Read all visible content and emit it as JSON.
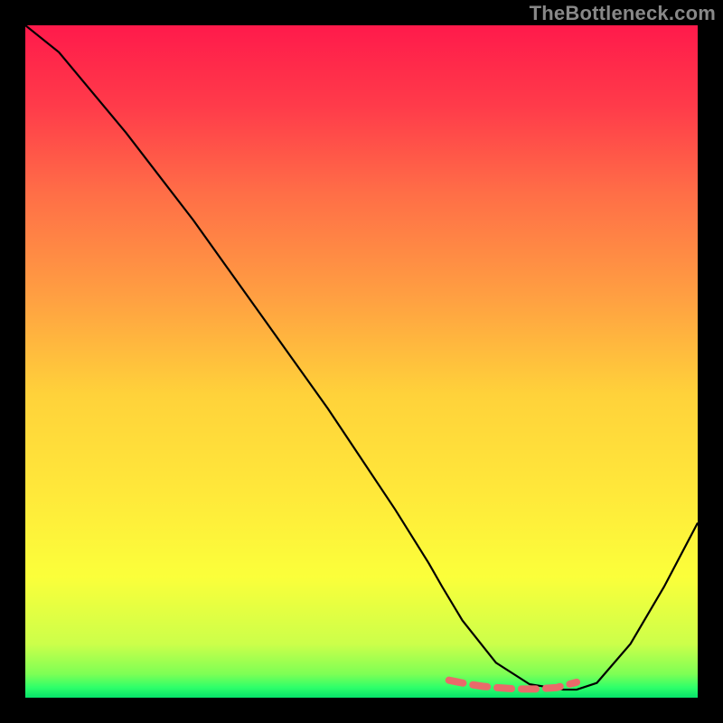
{
  "watermark": "TheBottleneck.com",
  "gradient": {
    "stops": [
      {
        "offset": 0.0,
        "color": "#ff1a4b"
      },
      {
        "offset": 0.12,
        "color": "#ff3b4a"
      },
      {
        "offset": 0.25,
        "color": "#ff6e47"
      },
      {
        "offset": 0.4,
        "color": "#ff9e42"
      },
      {
        "offset": 0.55,
        "color": "#ffd23a"
      },
      {
        "offset": 0.7,
        "color": "#ffe93a"
      },
      {
        "offset": 0.82,
        "color": "#fbff3a"
      },
      {
        "offset": 0.92,
        "color": "#ccff4a"
      },
      {
        "offset": 0.965,
        "color": "#7dff55"
      },
      {
        "offset": 0.985,
        "color": "#2dff6a"
      },
      {
        "offset": 1.0,
        "color": "#06e26a"
      }
    ]
  },
  "chart_data": {
    "type": "line",
    "title": "",
    "xlabel": "",
    "ylabel": "",
    "xlim": [
      0,
      100
    ],
    "ylim": [
      0,
      100
    ],
    "series": [
      {
        "name": "bottleneck-curve",
        "type": "line",
        "stroke": "#000000",
        "stroke_width": 2.2,
        "x": [
          0,
          5,
          10,
          15,
          20,
          25,
          30,
          35,
          40,
          45,
          50,
          55,
          60,
          62,
          65,
          70,
          75,
          80,
          82,
          85,
          90,
          95,
          100
        ],
        "values": [
          100,
          96,
          90,
          84,
          77.5,
          71,
          64,
          57,
          50,
          43,
          35.5,
          28,
          20,
          16.5,
          11.5,
          5.2,
          2.0,
          1.2,
          1.2,
          2.2,
          8.0,
          16.5,
          26
        ]
      },
      {
        "name": "optimal-band",
        "type": "line",
        "stroke": "#e96a6a",
        "stroke_width": 8,
        "dash": "16 11",
        "linecap": "round",
        "x": [
          63,
          66,
          68,
          70,
          73,
          76,
          79,
          82
        ],
        "values": [
          2.6,
          2.0,
          1.7,
          1.5,
          1.3,
          1.3,
          1.5,
          2.3
        ]
      }
    ]
  }
}
